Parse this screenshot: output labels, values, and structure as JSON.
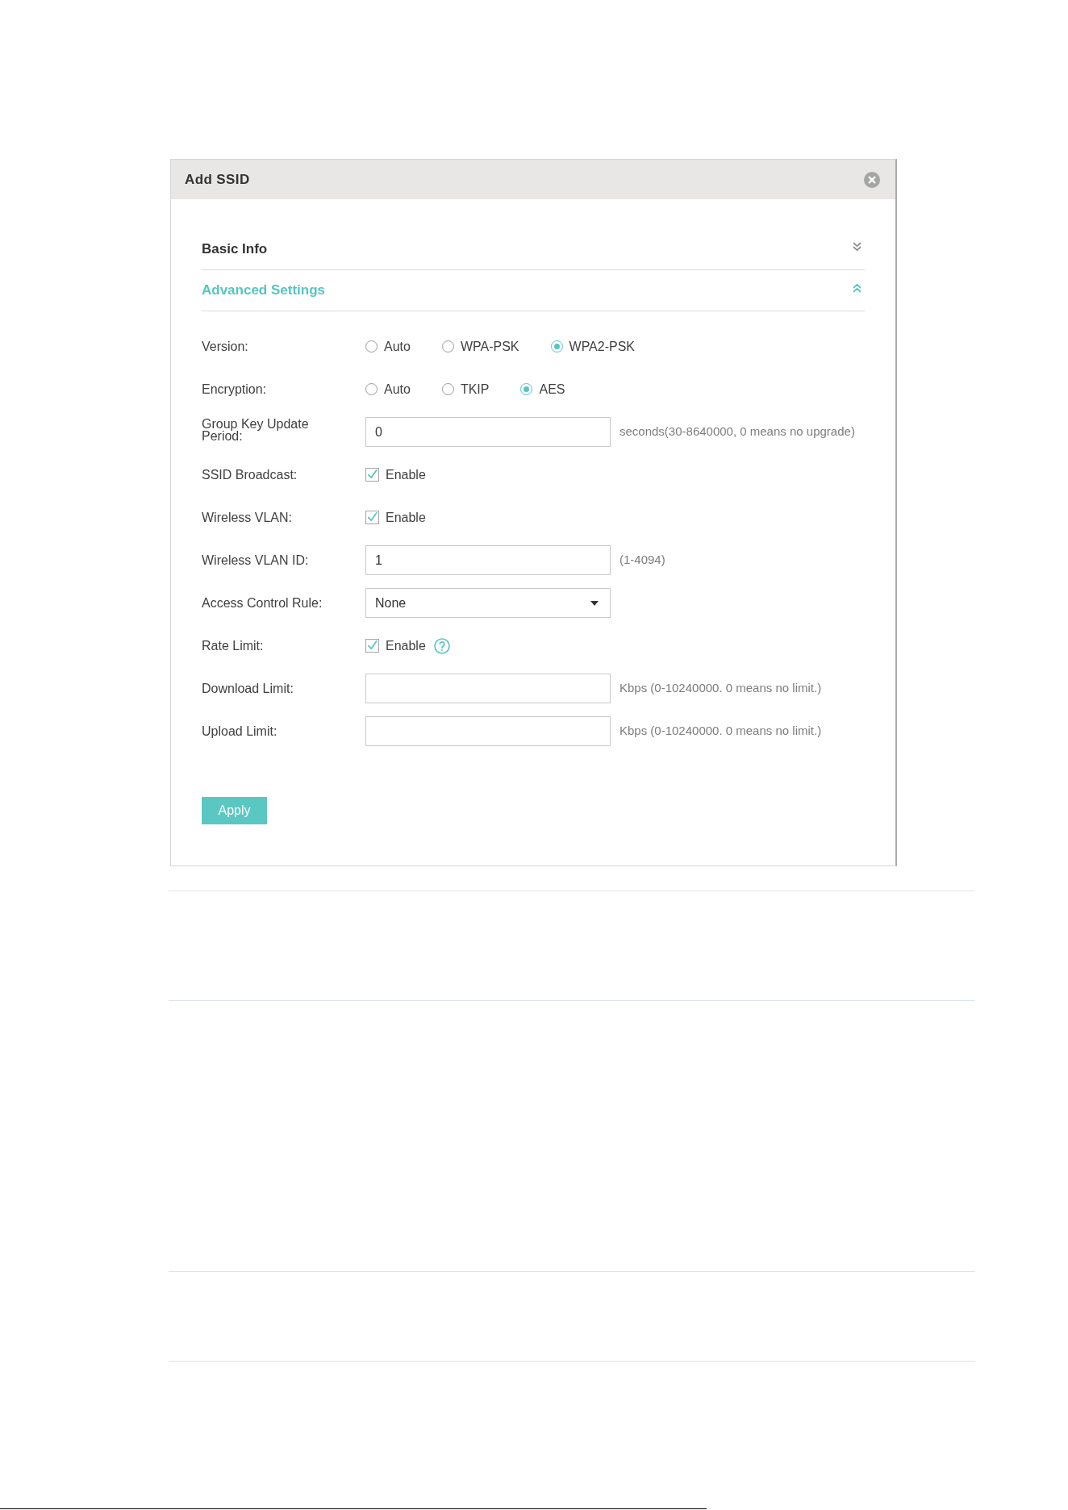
{
  "dialog": {
    "title": "Add SSID",
    "sections": [
      {
        "title": "Basic Info",
        "expanded": false
      },
      {
        "title": "Advanced Settings",
        "expanded": true
      }
    ],
    "fields": [
      {
        "kind": "radio",
        "label": "Version:",
        "options": [
          {
            "label": "Auto",
            "selected": false
          },
          {
            "label": "WPA-PSK",
            "selected": false
          },
          {
            "label": "WPA2-PSK",
            "selected": true
          }
        ]
      },
      {
        "kind": "radio",
        "label": "Encryption:",
        "options": [
          {
            "label": "Auto",
            "selected": false
          },
          {
            "label": "TKIP",
            "selected": false
          },
          {
            "label": "AES",
            "selected": true
          }
        ]
      },
      {
        "kind": "text",
        "label": "Group Key Update Period:",
        "value": "0",
        "hint": "seconds(30-8640000, 0 means no upgrade)"
      },
      {
        "kind": "checkbox",
        "label": "SSID Broadcast:",
        "option": "Enable",
        "checked": true
      },
      {
        "kind": "checkbox",
        "label": "Wireless VLAN:",
        "option": "Enable",
        "checked": true
      },
      {
        "kind": "text",
        "label": "Wireless VLAN ID:",
        "value": "1",
        "hint": "(1-4094)"
      },
      {
        "kind": "select",
        "label": "Access Control Rule:",
        "value": "None"
      },
      {
        "kind": "checkbox",
        "label": "Rate Limit:",
        "option": "Enable",
        "checked": true,
        "help": true
      },
      {
        "kind": "text",
        "label": "Download Limit:",
        "hint": "Kbps (0-10240000. 0 means no limit.)"
      },
      {
        "kind": "text",
        "label": "Upload Limit:",
        "hint": "Kbps (0-10240000. 0 means no limit.)"
      }
    ],
    "buttons": [
      {
        "label": "Apply"
      }
    ]
  }
}
